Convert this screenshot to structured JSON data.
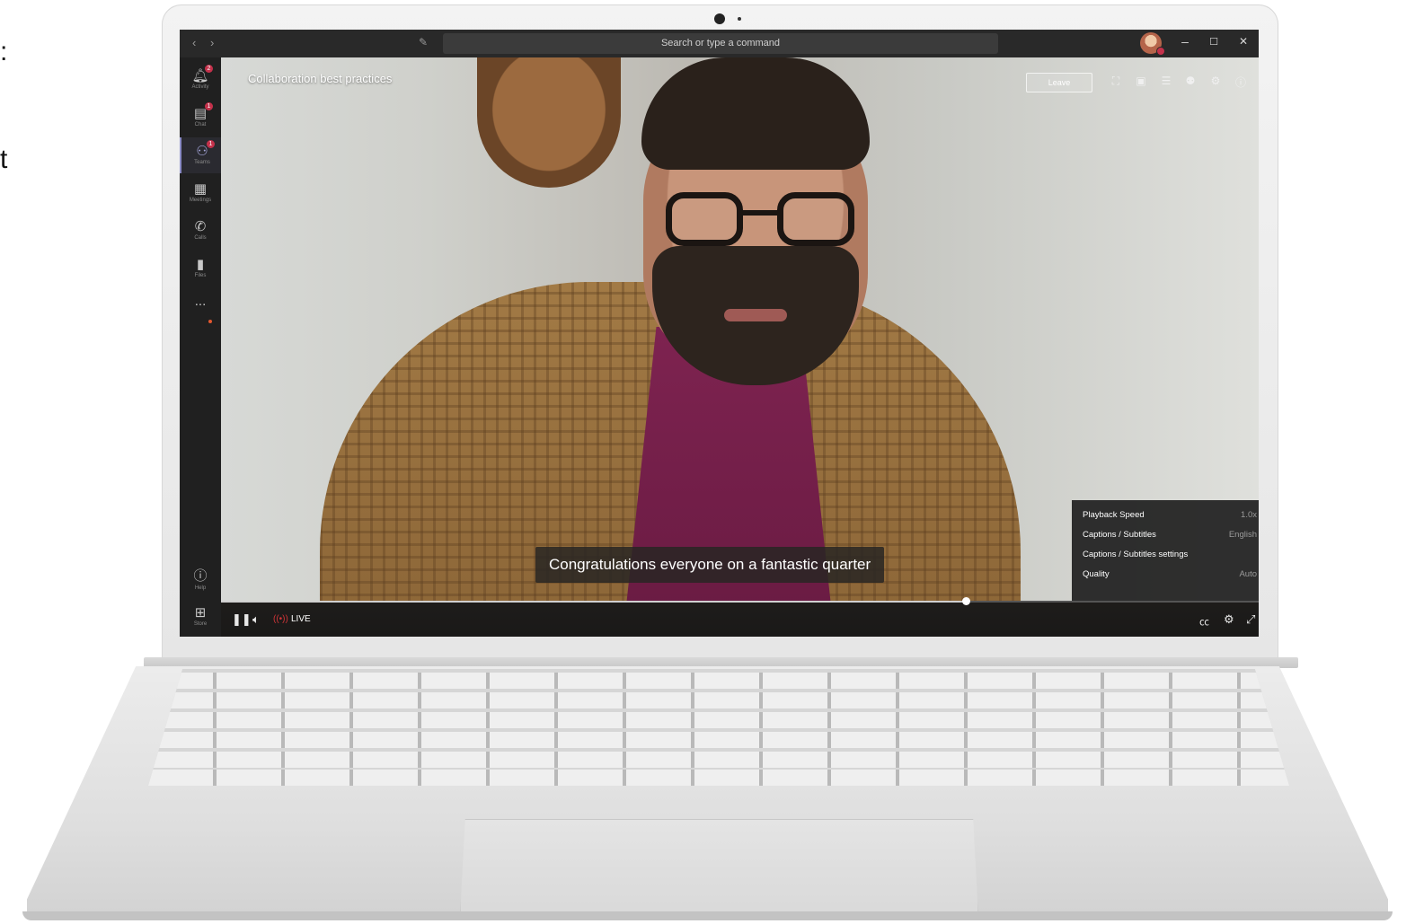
{
  "window": {
    "nav_back_icon": "chevron-left-icon",
    "nav_forward_icon": "chevron-right-icon",
    "compose_icon": "compose-icon",
    "search_placeholder": "Search or type a command",
    "controls": {
      "minimize": "–",
      "maximize": "☐",
      "close": "✕"
    }
  },
  "rail": {
    "items": [
      {
        "label": "Activity",
        "badge": "2"
      },
      {
        "label": "Chat",
        "badge": "1"
      },
      {
        "label": "Teams",
        "badge": "1"
      },
      {
        "label": "Meetings",
        "badge": ""
      },
      {
        "label": "Calls",
        "badge": ""
      },
      {
        "label": "Files",
        "badge": ""
      },
      {
        "label": "...",
        "badge": ""
      }
    ],
    "help_label": "Help",
    "store_label": "Store"
  },
  "meeting": {
    "title": "Collaboration best practices",
    "leave_label": "Leave",
    "caption": "Congratulations everyone on a fantastic quarter"
  },
  "settings": {
    "rows": [
      {
        "key": "Playback Speed",
        "value": "1.0x"
      },
      {
        "key": "Captions / Subtitles",
        "value": "English"
      },
      {
        "key": "Captions / Subtitles settings",
        "value": ""
      },
      {
        "key": "Quality",
        "value": "Auto"
      }
    ]
  },
  "player": {
    "live_label": "LIVE",
    "progress": 0.718
  },
  "edge_text": [
    ":",
    "t"
  ]
}
